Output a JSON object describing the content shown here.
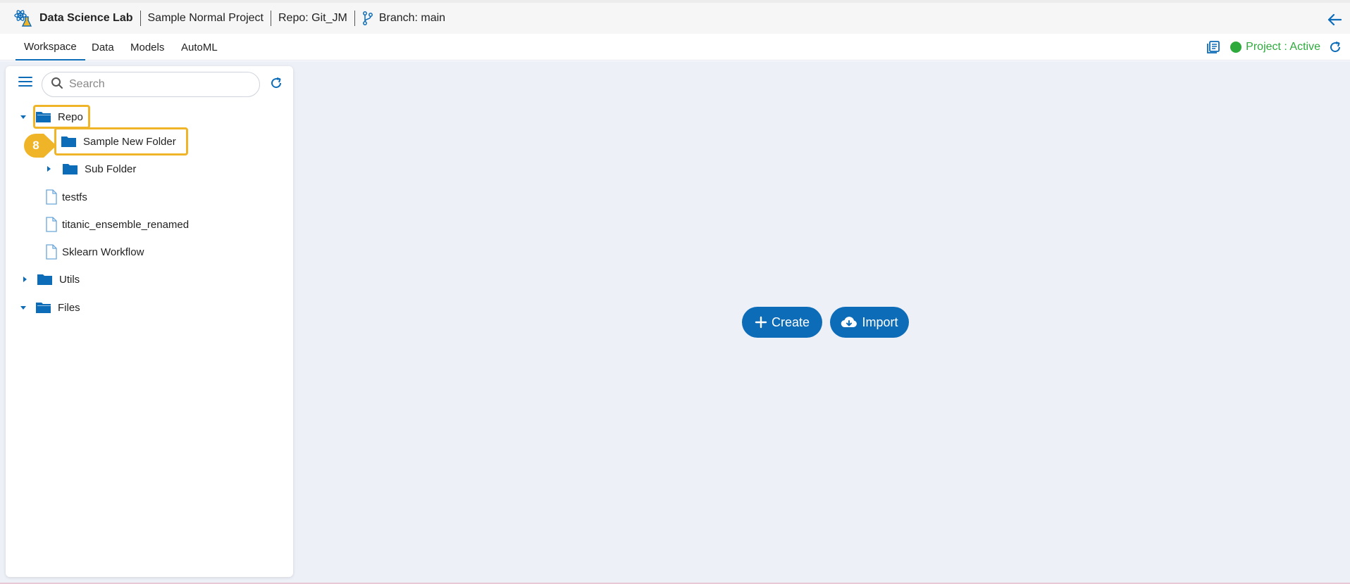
{
  "header": {
    "app_name": "Data Science Lab",
    "project_name": "Sample Normal Project",
    "repo": "Repo: Git_JM",
    "branch": "Branch: main"
  },
  "nav": {
    "tabs": [
      {
        "label": "Workspace",
        "active": true
      },
      {
        "label": "Data",
        "active": false
      },
      {
        "label": "Models",
        "active": false
      },
      {
        "label": "AutoML",
        "active": false
      }
    ],
    "project_status": "Project : Active"
  },
  "sidebar": {
    "search_placeholder": "Search",
    "tree": [
      {
        "label": "Repo",
        "type": "folder-open",
        "expanded": true
      },
      {
        "label": "Sample New Folder",
        "type": "folder",
        "highlighted": true
      },
      {
        "label": "Sub Folder",
        "type": "folder",
        "expanded": false
      },
      {
        "label": "testfs",
        "type": "file"
      },
      {
        "label": "titanic_ensemble_renamed",
        "type": "file"
      },
      {
        "label": "Sklearn Workflow",
        "type": "file"
      },
      {
        "label": "Utils",
        "type": "folder",
        "expanded": false
      },
      {
        "label": "Files",
        "type": "folder-open",
        "expanded": true
      }
    ],
    "step_badge": "8"
  },
  "main": {
    "create_label": "Create",
    "import_label": "Import"
  },
  "colors": {
    "accent": "#0d6cb8",
    "status_active": "#2eaa3c",
    "highlight": "#f0b429",
    "workspace_bg": "#eef0f8"
  }
}
